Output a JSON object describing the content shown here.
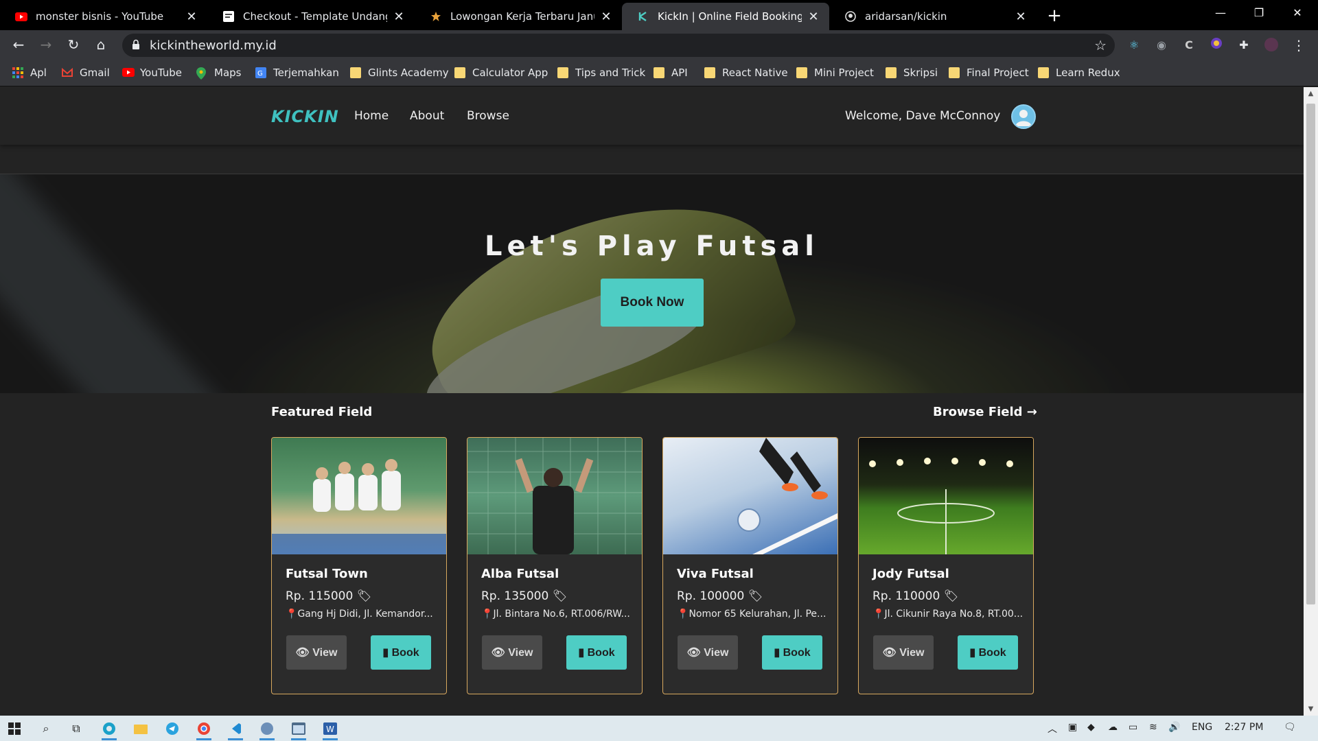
{
  "browser": {
    "tabs": [
      {
        "title": "monster bisnis - YouTube",
        "icon": "youtube-icon"
      },
      {
        "title": "Checkout - Template Undangan D",
        "icon": "page-icon"
      },
      {
        "title": "Lowongan Kerja Terbaru Januari 2",
        "icon": "glints-icon"
      },
      {
        "title": "KickIn | Online Field Booking",
        "icon": "kickin-icon"
      },
      {
        "title": "aridarsan/kickin",
        "icon": "github-icon"
      }
    ],
    "active_tab": 3,
    "url": "kickintheworld.my.id",
    "bookmarks": [
      "Apl",
      "Gmail",
      "YouTube",
      "Maps",
      "Terjemahkan",
      "Glints Academy",
      "Calculator App",
      "Tips and Trick",
      "API",
      "React Native",
      "Mini Project",
      "Skripsi",
      "Final Project",
      "Learn Redux"
    ]
  },
  "site": {
    "logo": "KICKIN",
    "nav": [
      "Home",
      "About",
      "Browse"
    ],
    "welcome": "Welcome, Dave McConnoy",
    "accent": "#4ecdc4"
  },
  "hero": {
    "title": "Let's Play Futsal",
    "cta": "Book Now"
  },
  "featured": {
    "title": "Featured Field",
    "browse_link": "Browse Field →",
    "fields": [
      {
        "name": "Futsal Town",
        "price": "Rp. 115000",
        "address": "Gang Hj Didi, Jl. Kemandor...",
        "view_label": "View",
        "book_label": "Book"
      },
      {
        "name": "Alba Futsal",
        "price": "Rp. 135000",
        "address": "Jl. Bintara No.6, RT.006/RW...",
        "view_label": "View",
        "book_label": "Book"
      },
      {
        "name": "Viva Futsal",
        "price": "Rp. 100000",
        "address": "Nomor 65 Kelurahan, Jl. Pe...",
        "view_label": "View",
        "book_label": "Book"
      },
      {
        "name": "Jody Futsal",
        "price": "Rp. 110000",
        "address": "Jl. Cikunir Raya No.8, RT.00...",
        "view_label": "View",
        "book_label": "Book"
      }
    ]
  },
  "taskbar": {
    "language": "ENG",
    "time": "2:27 PM"
  }
}
